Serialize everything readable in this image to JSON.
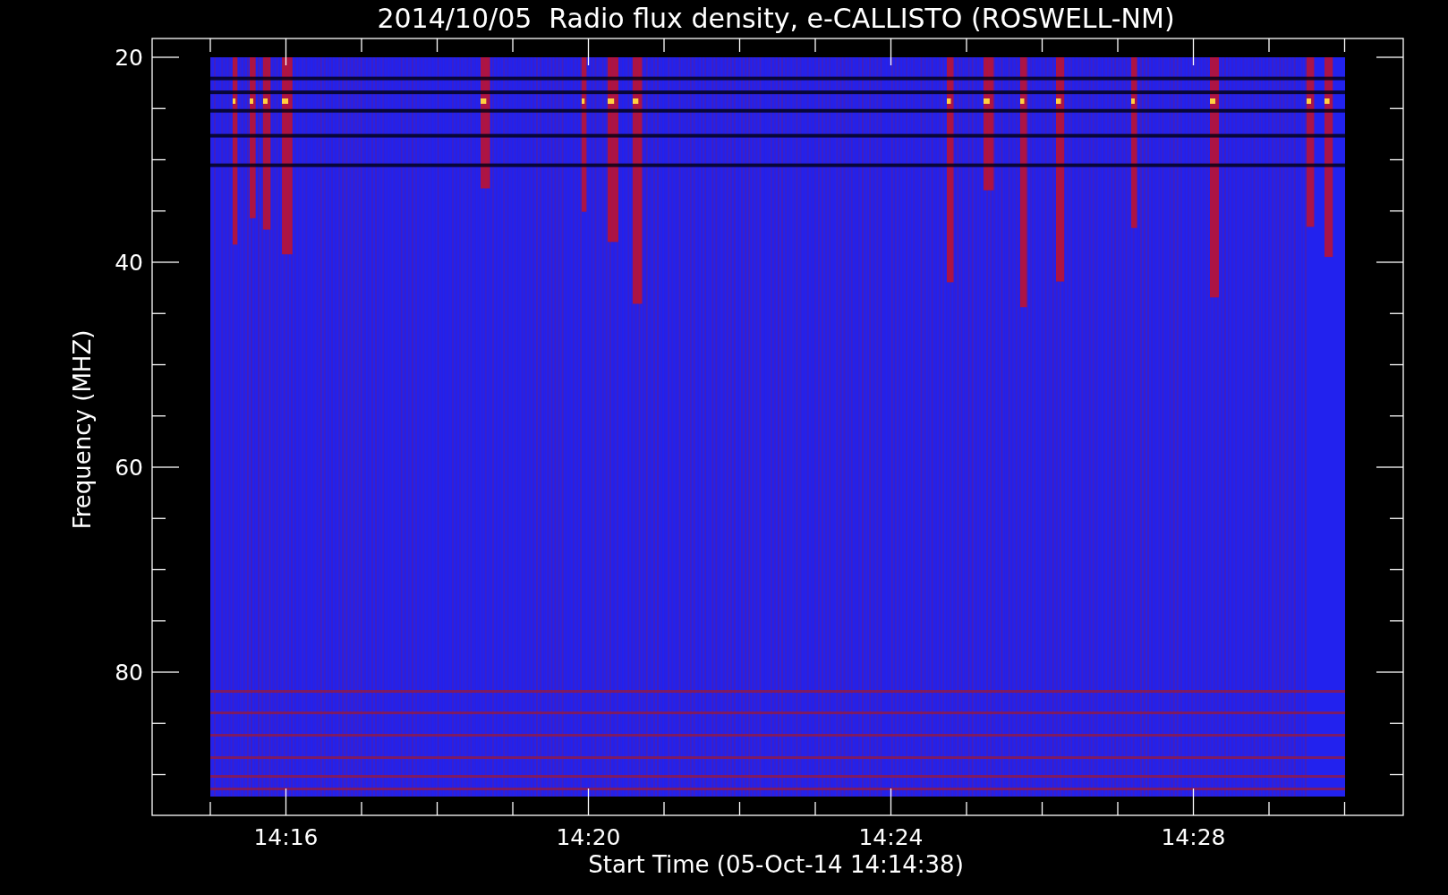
{
  "title": "2014/10/05  Radio flux density, e-CALLISTO (ROSWELL-NM)",
  "y_axis": {
    "label": "Frequency (MHZ)",
    "ticks": [
      "20",
      "40",
      "60",
      "80"
    ]
  },
  "x_axis": {
    "label": "Start Time (05-Oct-14 14:14:38)",
    "ticks": [
      "14:16",
      "14:20",
      "14:24",
      "14:28"
    ]
  }
}
